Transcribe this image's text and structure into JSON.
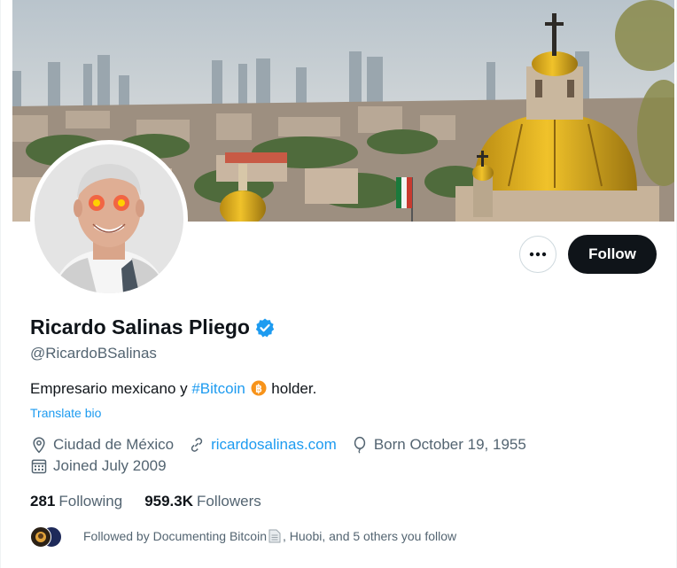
{
  "profile": {
    "name": "Ricardo Salinas Pliego",
    "handle": "@RicardoBSalinas",
    "bio_prefix": "Empresario mexicano y ",
    "bio_hashtag": "#Bitcoin",
    "bio_suffix": " holder.",
    "translate_label": "Translate bio"
  },
  "meta": {
    "location": "Ciudad de México",
    "website": "ricardosalinas.com",
    "birthday": "Born October 19, 1955",
    "joined": "Joined July 2009"
  },
  "stats": {
    "following_count": "281",
    "following_label": "Following",
    "followers_count": "959.3K",
    "followers_label": "Followers"
  },
  "followed_by": {
    "prefix": "Followed by Documenting Bitcoin ",
    "suffix": ", Huobi, and 5 others you follow"
  },
  "actions": {
    "follow_label": "Follow"
  },
  "icons": {
    "verified": "verified-badge-icon",
    "more": "more-dots-icon",
    "location": "location-pin-icon",
    "link": "link-icon",
    "birthday": "balloon-icon",
    "calendar": "calendar-icon",
    "bitcoin": "bitcoin-emoji-icon",
    "document": "document-emoji-icon"
  },
  "colors": {
    "accent": "#1d9bf0",
    "text": "#0f1419",
    "muted": "#536471",
    "follow_bg": "#0f1419",
    "bitcoin": "#f7931a"
  }
}
